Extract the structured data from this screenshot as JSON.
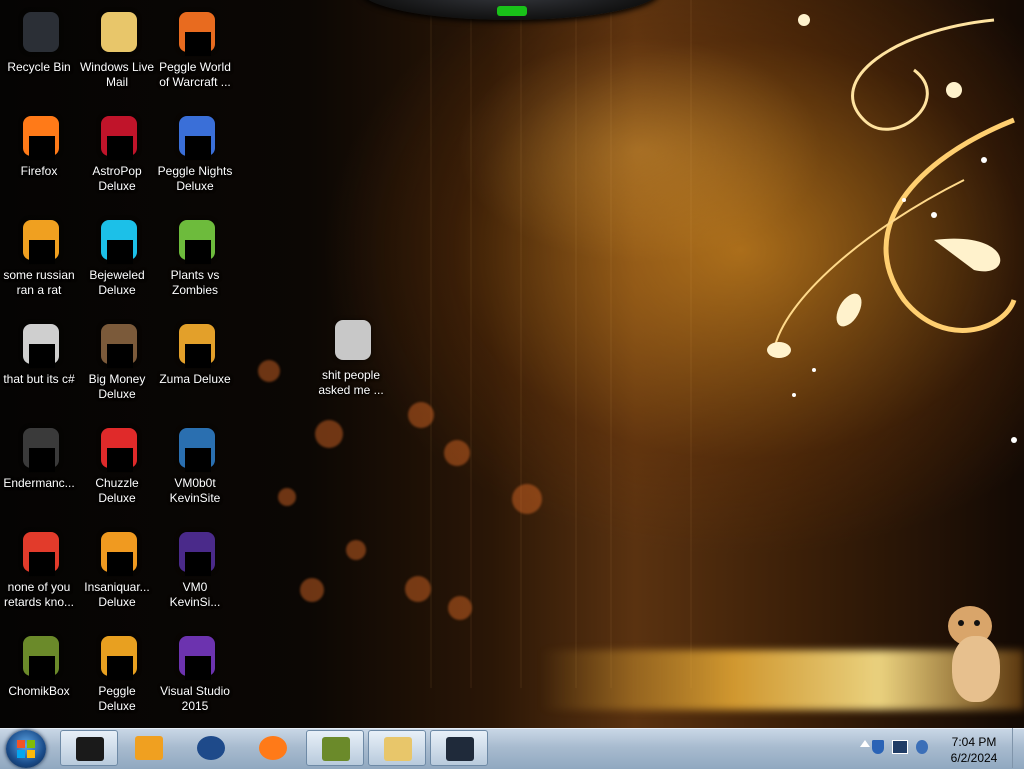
{
  "desktop": {
    "icons": [
      {
        "label": "Recycle Bin",
        "icon": "recycle-bin-icon"
      },
      {
        "label": "Windows Live Mail",
        "icon": "windows-live-mail-icon"
      },
      {
        "label": "Peggle World of Warcraft ...",
        "icon": "peggle-wow-icon"
      },
      {
        "label": "Firefox",
        "icon": "firefox-icon"
      },
      {
        "label": "AstroPop Deluxe",
        "icon": "astropop-icon"
      },
      {
        "label": "Peggle Nights Deluxe",
        "icon": "peggle-nights-icon"
      },
      {
        "label": "some russian ran a rat",
        "icon": "executable-icon"
      },
      {
        "label": "Bejeweled Deluxe",
        "icon": "bejeweled-icon"
      },
      {
        "label": "Plants vs Zombies",
        "icon": "plants-vs-zombies-icon"
      },
      {
        "label": "that but its c#",
        "icon": "shortcut-icon"
      },
      {
        "label": "Big Money Deluxe",
        "icon": "big-money-icon"
      },
      {
        "label": "Zuma Deluxe",
        "icon": "zuma-icon"
      },
      {
        "label": "Endermanc...",
        "icon": "window-app-icon"
      },
      {
        "label": "Chuzzle Deluxe",
        "icon": "chuzzle-icon"
      },
      {
        "label": "VM0b0t KevinSite",
        "icon": "vm-window-icon"
      },
      {
        "label": "none of you retards kno...",
        "icon": "chrome-like-icon"
      },
      {
        "label": "Insaniquar... Deluxe",
        "icon": "insaniquarium-icon"
      },
      {
        "label": "VM0 KevinSi...",
        "icon": "document-icon"
      },
      {
        "label": "ChomikBox",
        "icon": "chomikbox-icon"
      },
      {
        "label": "Peggle Deluxe",
        "icon": "peggle-icon"
      },
      {
        "label": "Visual Studio 2015",
        "icon": "visual-studio-icon"
      },
      {
        "label": "shit people asked me ...",
        "icon": "folder-icon"
      }
    ]
  },
  "taskbar": {
    "items": [
      {
        "name": "taskbar-item-terminal",
        "icon": "terminal-icon",
        "active": true
      },
      {
        "name": "taskbar-item-media-player",
        "icon": "media-player-icon",
        "active": false
      },
      {
        "name": "taskbar-item-app",
        "icon": "globe-app-icon",
        "active": false
      },
      {
        "name": "taskbar-item-firefox",
        "icon": "firefox-icon",
        "active": false
      },
      {
        "name": "taskbar-item-chomikbox",
        "icon": "chomikbox-icon",
        "active": true
      },
      {
        "name": "taskbar-item-explorer",
        "icon": "explorer-icon",
        "active": true
      },
      {
        "name": "taskbar-item-window",
        "icon": "window-app-icon",
        "active": true
      }
    ],
    "clock": {
      "time": "7:04 PM",
      "date": "6/2/2024"
    }
  },
  "colors": {
    "taskbar": "#a8bbcf",
    "accent_gold": "#ffb640"
  }
}
